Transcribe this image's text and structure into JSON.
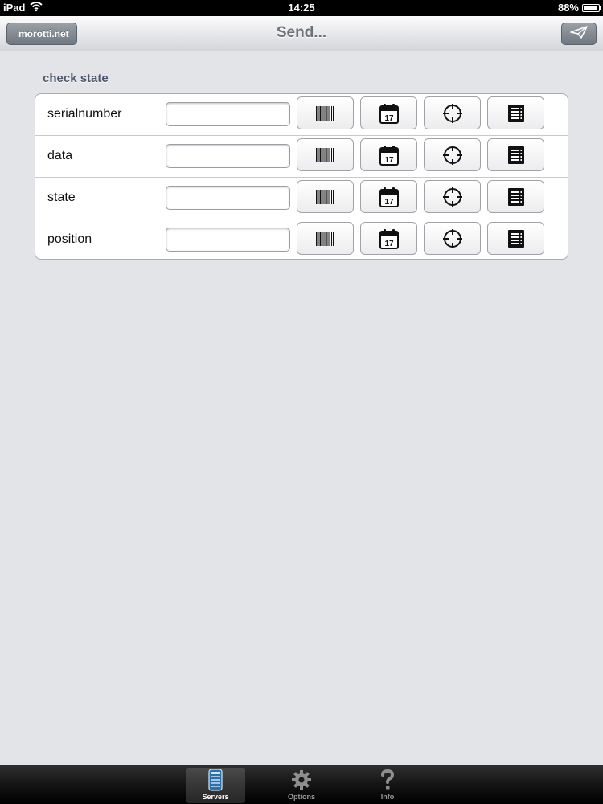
{
  "status_bar": {
    "device": "iPad",
    "time": "14:25",
    "battery": "88%",
    "battery_level": 0.88
  },
  "nav": {
    "back_label": "morotti.net",
    "title": "Send...",
    "send_icon": "paper-plane-icon"
  },
  "section": {
    "title": "check state"
  },
  "fields": [
    {
      "label": "serialnumber",
      "value": ""
    },
    {
      "label": "data",
      "value": ""
    },
    {
      "label": "state",
      "value": ""
    },
    {
      "label": "position",
      "value": ""
    }
  ],
  "field_buttons": [
    "barcode-icon",
    "calendar-icon",
    "crosshair-icon",
    "list-icon"
  ],
  "calendar_day": "17",
  "tabs": [
    {
      "label": "Servers",
      "icon": "server-icon",
      "active": true
    },
    {
      "label": "Options",
      "icon": "gear-icon",
      "active": false
    },
    {
      "label": "Info",
      "icon": "question-icon",
      "active": false
    }
  ]
}
